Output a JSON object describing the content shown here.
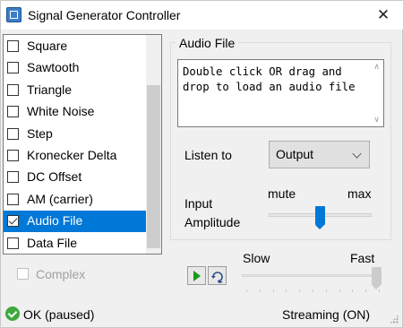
{
  "window": {
    "title": "Signal Generator Controller",
    "close_glyph": "✕"
  },
  "signal_list": {
    "items": [
      {
        "label": "Square",
        "checked": false,
        "selected": false
      },
      {
        "label": "Sawtooth",
        "checked": false,
        "selected": false
      },
      {
        "label": "Triangle",
        "checked": false,
        "selected": false
      },
      {
        "label": "White Noise",
        "checked": false,
        "selected": false
      },
      {
        "label": "Step",
        "checked": false,
        "selected": false
      },
      {
        "label": "Kronecker Delta",
        "checked": false,
        "selected": false
      },
      {
        "label": "DC Offset",
        "checked": false,
        "selected": false
      },
      {
        "label": "AM (carrier)",
        "checked": false,
        "selected": false
      },
      {
        "label": "Audio File",
        "checked": true,
        "selected": true
      },
      {
        "label": "Data File",
        "checked": false,
        "selected": false
      }
    ],
    "selection_color": "#0078d7"
  },
  "complex": {
    "label": "Complex",
    "checked": false,
    "enabled": false
  },
  "audio_panel": {
    "title": "Audio File",
    "hint_text": "Double click OR drag and drop to load an audio file",
    "listen_label": "Listen to",
    "listen_value": "Output",
    "input_label_line1": "Input",
    "input_label_line2": "Amplitude",
    "mute_label": "mute",
    "max_label": "max",
    "amplitude_level": 0.5,
    "accent_color": "#0078d7"
  },
  "playback": {
    "play_icon": "play-icon",
    "loop_icon": "loop-icon",
    "slow_label": "Slow",
    "fast_label": "Fast",
    "speed_level": 1.0
  },
  "status_bar": {
    "status_text": "OK (paused)",
    "streaming_text": "Streaming (ON)",
    "status_color": "#3ea83e"
  }
}
